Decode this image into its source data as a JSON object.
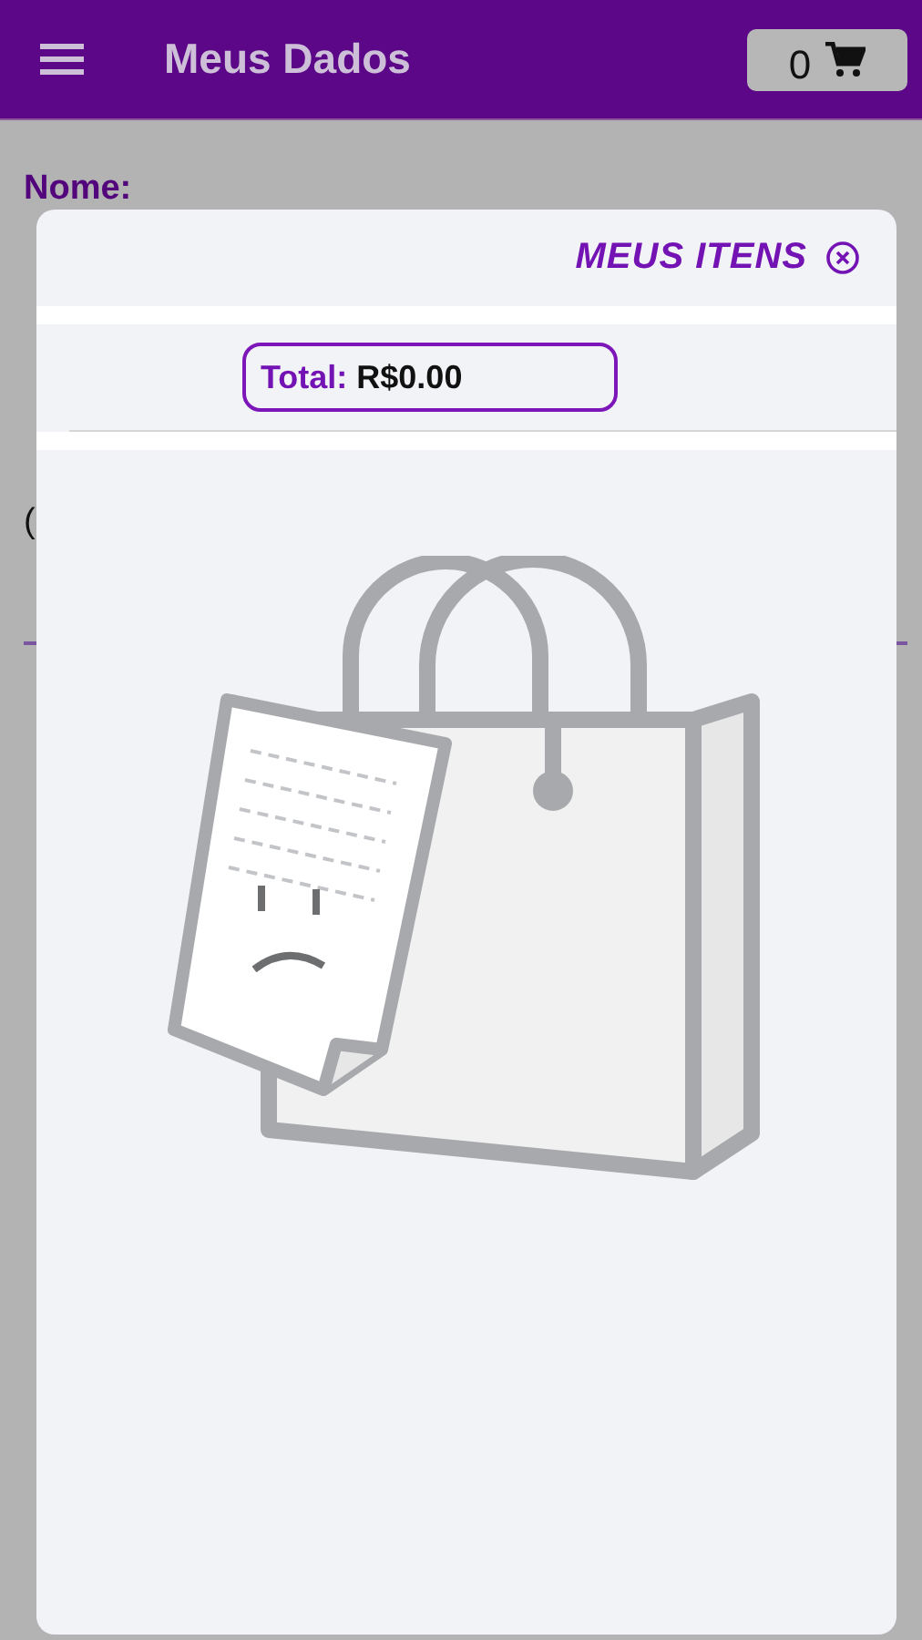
{
  "app_bar": {
    "title": "Meus Dados",
    "cart_count": "0"
  },
  "profile_fields": [
    {
      "kind": "label",
      "text": "Nome:"
    },
    {
      "kind": "value",
      "text": "("
    }
  ],
  "cart_dialog": {
    "title": "MEUS ITENS",
    "total_label": "Total:",
    "total_value": "R$0.00",
    "empty": true
  }
}
